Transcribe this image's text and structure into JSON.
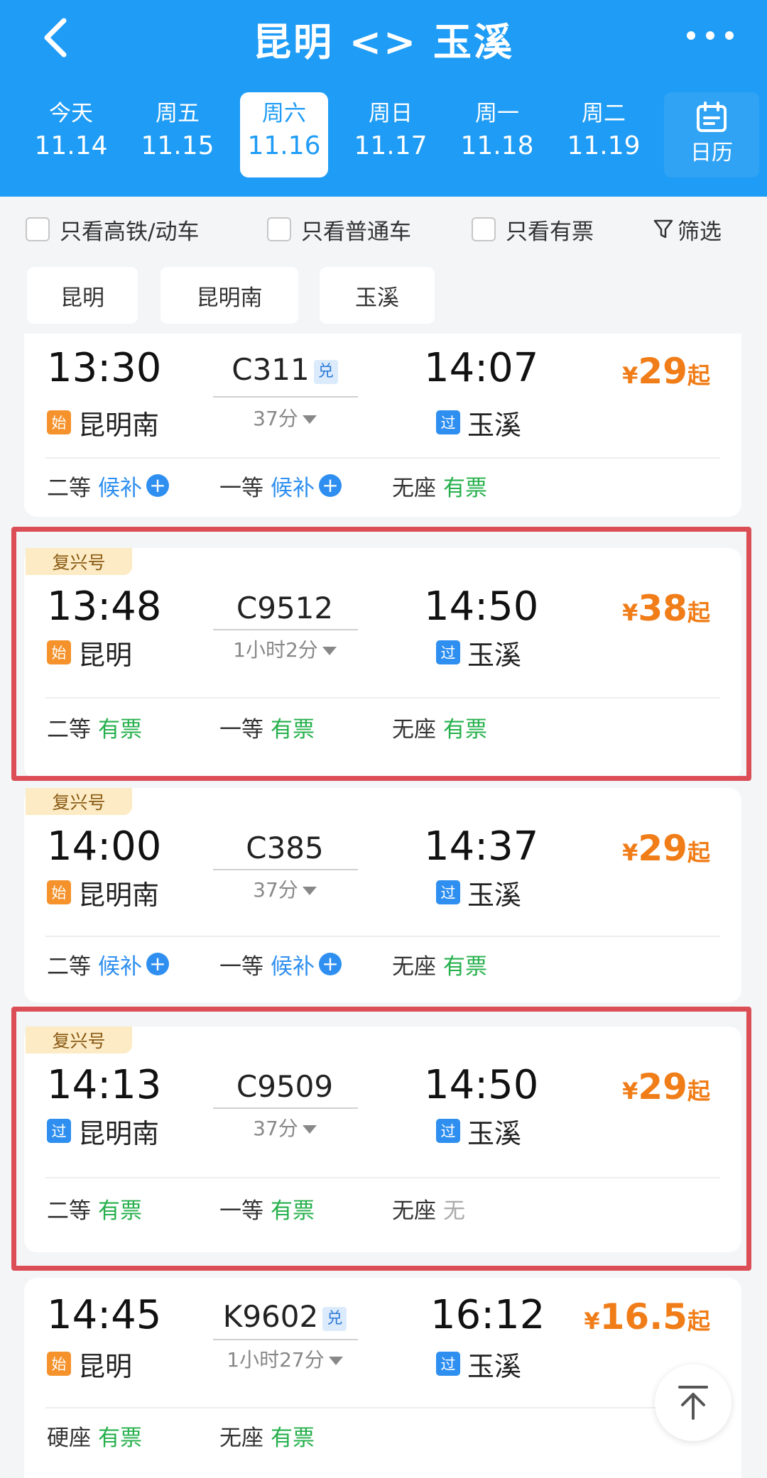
{
  "header": {
    "title": "昆明 <> 玉溪",
    "back_icon": "chevron-left-icon",
    "more_icon": "more-dots-icon",
    "date_tabs": [
      {
        "weekday": "今天",
        "date": "11.14",
        "selected": false
      },
      {
        "weekday": "周五",
        "date": "11.15",
        "selected": false
      },
      {
        "weekday": "周六",
        "date": "11.16",
        "selected": true
      },
      {
        "weekday": "周日",
        "date": "11.17",
        "selected": false
      },
      {
        "weekday": "周一",
        "date": "11.18",
        "selected": false
      },
      {
        "weekday": "周二",
        "date": "11.19",
        "selected": false
      }
    ],
    "calendar_label": "日历",
    "calendar_icon": "calendar-icon"
  },
  "filters": {
    "high_speed": "只看高铁/动车",
    "normal": "只看普通车",
    "available": "只看有票",
    "filter_label": "筛选",
    "filter_icon": "funnel-icon"
  },
  "stations": [
    "昆明",
    "昆明南",
    "玉溪"
  ],
  "trains": [
    {
      "badge": "",
      "dep_time": "13:30",
      "arr_time": "14:07",
      "train_no": "C311",
      "exchange": "兑",
      "duration": "37分",
      "dep_tag": "始",
      "dep_station": "昆明南",
      "arr_tag": "过",
      "arr_station": "玉溪",
      "price_symbol": "¥",
      "price": "29",
      "price_suffix": "起",
      "seats": [
        {
          "name": "二等",
          "status": "候补",
          "plus": true
        },
        {
          "name": "一等",
          "status": "候补",
          "plus": true
        },
        {
          "name": "无座",
          "status": "有票",
          "plus": false
        }
      ]
    },
    {
      "badge": "复兴号",
      "dep_time": "13:48",
      "arr_time": "14:50",
      "train_no": "C9512",
      "exchange": "",
      "duration": "1小时2分",
      "dep_tag": "始",
      "dep_station": "昆明",
      "arr_tag": "过",
      "arr_station": "玉溪",
      "price_symbol": "¥",
      "price": "38",
      "price_suffix": "起",
      "seats": [
        {
          "name": "二等",
          "status": "有票",
          "plus": false
        },
        {
          "name": "一等",
          "status": "有票",
          "plus": false
        },
        {
          "name": "无座",
          "status": "有票",
          "plus": false
        }
      ]
    },
    {
      "badge": "复兴号",
      "dep_time": "14:00",
      "arr_time": "14:37",
      "train_no": "C385",
      "exchange": "",
      "duration": "37分",
      "dep_tag": "始",
      "dep_station": "昆明南",
      "arr_tag": "过",
      "arr_station": "玉溪",
      "price_symbol": "¥",
      "price": "29",
      "price_suffix": "起",
      "seats": [
        {
          "name": "二等",
          "status": "候补",
          "plus": true
        },
        {
          "name": "一等",
          "status": "候补",
          "plus": true
        },
        {
          "name": "无座",
          "status": "有票",
          "plus": false
        }
      ]
    },
    {
      "badge": "复兴号",
      "dep_time": "14:13",
      "arr_time": "14:50",
      "train_no": "C9509",
      "exchange": "",
      "duration": "37分",
      "dep_tag": "过",
      "dep_station": "昆明南",
      "arr_tag": "过",
      "arr_station": "玉溪",
      "price_symbol": "¥",
      "price": "29",
      "price_suffix": "起",
      "seats": [
        {
          "name": "二等",
          "status": "有票",
          "plus": false
        },
        {
          "name": "一等",
          "status": "有票",
          "plus": false
        },
        {
          "name": "无座",
          "status": "无",
          "plus": false
        }
      ]
    },
    {
      "badge": "",
      "dep_time": "14:45",
      "arr_time": "16:12",
      "train_no": "K9602",
      "exchange": "兑",
      "duration": "1小时27分",
      "dep_tag": "始",
      "dep_station": "昆明",
      "arr_tag": "过",
      "arr_station": "玉溪",
      "price_symbol": "¥",
      "price": "16.5",
      "price_suffix": "起",
      "seats": [
        {
          "name": "硬座",
          "status": "有票",
          "plus": false
        },
        {
          "name": "无座",
          "status": "有票",
          "plus": false
        }
      ]
    }
  ],
  "plus_symbol": "+",
  "scroll_top_icon": "scroll-to-top-icon",
  "colors": {
    "brand_blue": "#1f9cf5",
    "price_orange": "#f07d18",
    "available_green": "#26b04c",
    "waitlist_blue": "#2f8ff0",
    "highlight_red": "#dc4e56"
  }
}
